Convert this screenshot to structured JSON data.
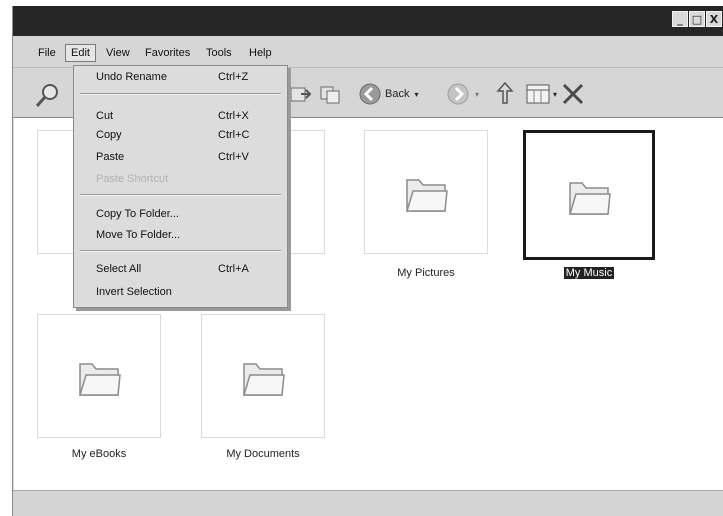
{
  "window": {
    "controls": [
      "_",
      "□",
      "X"
    ]
  },
  "menubar": [
    "File",
    "Edit",
    "View",
    "Favorites",
    "Tools",
    "Help"
  ],
  "toolbar": {
    "back_label": "Back"
  },
  "edit_menu": {
    "items": [
      {
        "label": "Undo Rename",
        "shortcut": "Ctrl+Z",
        "enabled": true
      },
      {
        "label": "Cut",
        "shortcut": "Ctrl+X",
        "enabled": true
      },
      {
        "label": "Copy",
        "shortcut": "Ctrl+C",
        "enabled": true
      },
      {
        "label": "Paste",
        "shortcut": "Ctrl+V",
        "enabled": true
      },
      {
        "label": "Paste Shortcut",
        "shortcut": "",
        "enabled": false
      },
      {
        "label": "Copy To Folder...",
        "shortcut": "",
        "enabled": true
      },
      {
        "label": "Move To Folder...",
        "shortcut": "",
        "enabled": true
      },
      {
        "label": "Select All",
        "shortcut": "Ctrl+A",
        "enabled": true
      },
      {
        "label": "Invert Selection",
        "shortcut": "",
        "enabled": true
      }
    ]
  },
  "folders": [
    {
      "name": "",
      "selected": false
    },
    {
      "name": "",
      "selected": false
    },
    {
      "name": "My Pictures",
      "selected": false
    },
    {
      "name": "My Music",
      "selected": true
    },
    {
      "name": "My eBooks",
      "selected": false
    },
    {
      "name": "My Documents",
      "selected": false
    }
  ],
  "colors": {
    "selection": "#222222",
    "titlebar": "#262626",
    "chrome": "#d6d6d6"
  }
}
